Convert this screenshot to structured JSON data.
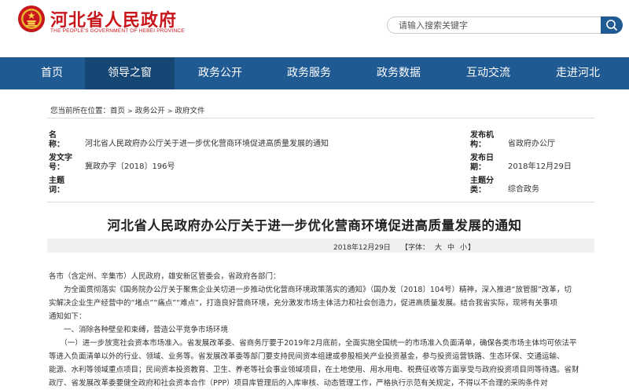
{
  "header": {
    "site_name": "河北省人民政府",
    "site_sub": "THE PEOPLE'S GOVERNMENT OF HEBEI PROVINCE",
    "search_placeholder": "请输入搜索关键字",
    "brand_color": "#c8161d"
  },
  "nav": {
    "items": [
      "首页",
      "领导之窗",
      "政务公开",
      "政务服务",
      "政务数据",
      "互动交流",
      "走进河北"
    ],
    "active_index": 1,
    "color": "#1f5a93"
  },
  "breadcrumb": {
    "prefix": "您当前所在位置：",
    "items": [
      "首页",
      "政务公开",
      "政府文件"
    ]
  },
  "meta": {
    "name_label": "名　　称：",
    "name_value": "河北省人民政府办公厅关于进一步优化营商环境促进高质量发展的通知",
    "docno_label": "发文字号：",
    "docno_value": "冀政办字〔2018〕196号",
    "topic_label": "主题词：",
    "publisher_label": "发布机构：",
    "publisher_value": "省政府办公厅",
    "pubdate_label": "发布日期：",
    "pubdate_value": "2018年12月29日",
    "category_label": "主题分类：",
    "category_value": "综合政务"
  },
  "article": {
    "title": "河北省人民政府办公厅关于进一步优化营商环境促进高质量发展的通知",
    "date": "2018年12月29日",
    "font_label": "【字体：",
    "font_large": "大",
    "font_medium": "中",
    "font_small": "小",
    "font_close": "】",
    "lines": [
      "各市（含定州、辛集市）人民政府，雄安新区管委会，省政府各部门：",
      "　　为全面贯彻落实《国务院办公厅关于聚焦企业关切进一步推动优化营商环境政策落实的通知》（国办发〔2018〕104号）精神，深入推进“放管服”改革，切",
      "实解决企业生产经营中的“堵点”“痛点”“难点”，打造良好营商环境，充分激发市场主体活力和社会创造力，促进高质量发展。结合我省实际，现将有关事项",
      "通知如下：",
      "　　一、消除各种壁垒和束缚，营造公平竞争市场环境",
      "　　（一）进一步放宽社会资本市场准入。省发展改革委、省商务厅要于2019年2月底前，全面实施全国统一的市场准入负面清单，确保各类市场主体均可依法平",
      "等进入负面清单以外的行业、领域、业务等。省发展改革委等部门要支持民间资本组建或参股相关产业投资基金，参与投资运营铁路、生态环保、交通运输、",
      "能源、水利等领域重点项目；民间资本投资教育、卫生、养老等社会事业领域项目，在土地使用、用水用电、税费征收等方面享受与政府投资项目同等待遇。省财",
      "政厅、省发展改革委要健全政府和社会资本合作（PPP）项目库管理后的入库审核、动态管理工作，严格执行示范有关规定，不得以不合理的采购条件对"
    ]
  }
}
